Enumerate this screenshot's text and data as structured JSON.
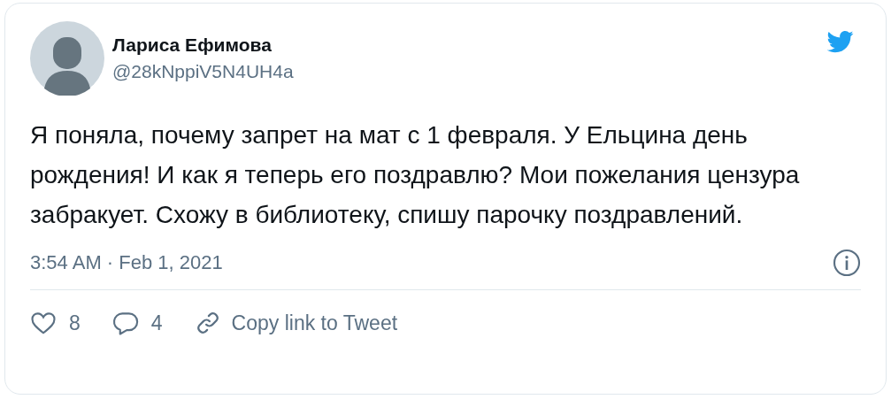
{
  "author": {
    "name": "Лариса Ефимова",
    "handle": "@28kNppiV5N4UH4a"
  },
  "text": "Я поняла, почему запрет на мат с 1 февраля. У Ельцина день рождения! И как я теперь его поздравлю? Мои пожелания цензура забракует. Схожу в библиотеку, спишу парочку поздравлений.",
  "timestamp": "3:54 AM · Feb 1, 2021",
  "actions": [
    {
      "kind": "like",
      "label": "8"
    },
    {
      "kind": "reply",
      "label": "4"
    },
    {
      "kind": "link",
      "label": "Copy link to Tweet"
    }
  ]
}
